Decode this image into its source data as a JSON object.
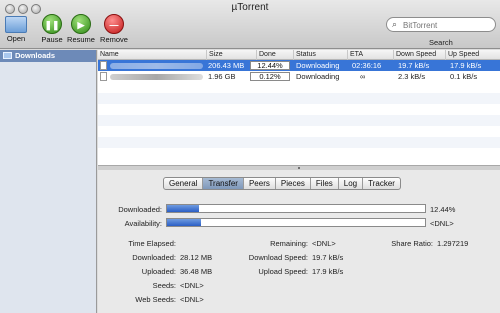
{
  "window": {
    "title": "µTorrent"
  },
  "toolbar": {
    "open_label": "Open",
    "pause_label": "Pause",
    "resume_label": "Resume",
    "remove_label": "Remove",
    "search_placeholder": "BitTorrent",
    "search_label": "Search"
  },
  "sidebar": {
    "items": [
      {
        "label": "Downloads"
      }
    ]
  },
  "list": {
    "columns": [
      "Name",
      "Size",
      "Done",
      "Status",
      "ETA",
      "Down Speed",
      "Up Speed"
    ],
    "rows": [
      {
        "name": "",
        "size": "206.43 MB",
        "done": "12.44%",
        "status": "Downloading",
        "eta": "02:36:16",
        "down": "19.7 kB/s",
        "up": "17.9 kB/s",
        "selected": true
      },
      {
        "name": "",
        "size": "1.96 GB",
        "done": "0.12%",
        "status": "Downloading",
        "eta": "∞",
        "down": "2.3 kB/s",
        "up": "0.1 kB/s",
        "selected": false
      }
    ]
  },
  "tabs": [
    "General",
    "Transfer",
    "Peers",
    "Pieces",
    "Files",
    "Log",
    "Tracker"
  ],
  "active_tab": "Transfer",
  "transfer": {
    "downloaded_bar": {
      "label": "Downloaded:",
      "value": "12.44%",
      "fraction": 0.1244
    },
    "availability_bar": {
      "label": "Availability:",
      "value": "<DNL>",
      "fraction": 0.13
    },
    "time_elapsed_label": "Time Elapsed:",
    "time_elapsed_value": "",
    "downloaded_label": "Downloaded:",
    "downloaded_value": "28.12 MB",
    "uploaded_label": "Uploaded:",
    "uploaded_value": "36.48 MB",
    "seeds_label": "Seeds:",
    "seeds_value": "<DNL>",
    "web_seeds_label": "Web Seeds:",
    "web_seeds_value": "<DNL>",
    "remaining_label": "Remaining:",
    "remaining_value": "<DNL>",
    "download_speed_label": "Download Speed:",
    "download_speed_value": "19.7 kB/s",
    "upload_speed_label": "Upload Speed:",
    "upload_speed_value": "17.9 kB/s",
    "share_ratio_label": "Share Ratio:",
    "share_ratio_value": "1.297219"
  }
}
